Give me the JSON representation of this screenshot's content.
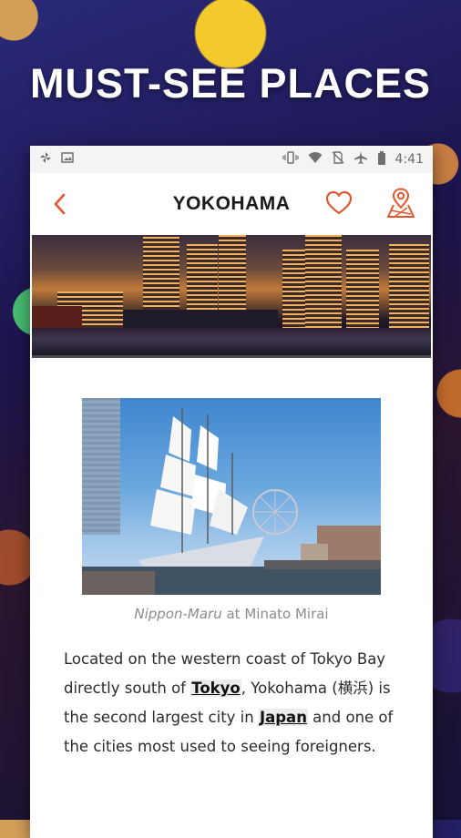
{
  "promo": {
    "title": "MUST-SEE PLACES"
  },
  "status_bar": {
    "time": "4:41"
  },
  "app_bar": {
    "title": "YOKOHAMA"
  },
  "photo": {
    "caption_italic": "Nippon-Maru",
    "caption_rest": " at Minato Mirai"
  },
  "article": {
    "p1": "Located on the western coast of Tokyo Bay directly south of ",
    "link_tokyo": "Tokyo",
    "p2": ", Yokohama (横浜) is the second largest city in ",
    "link_japan": "Japan",
    "p3": " and one of the cities most used to seeing foreigners."
  },
  "colors": {
    "accent": "#e4572e",
    "title": "#1a1a1a",
    "caption": "#8c8c8c"
  },
  "icons": {
    "back": "chevron-left-icon",
    "favorite": "heart-icon",
    "map": "map-pin-icon",
    "status_left": [
      "pinwheel-icon",
      "image-icon"
    ],
    "status_right": [
      "vibrate-icon",
      "wifi-icon",
      "no-sim-icon",
      "airplane-icon",
      "battery-icon"
    ]
  }
}
